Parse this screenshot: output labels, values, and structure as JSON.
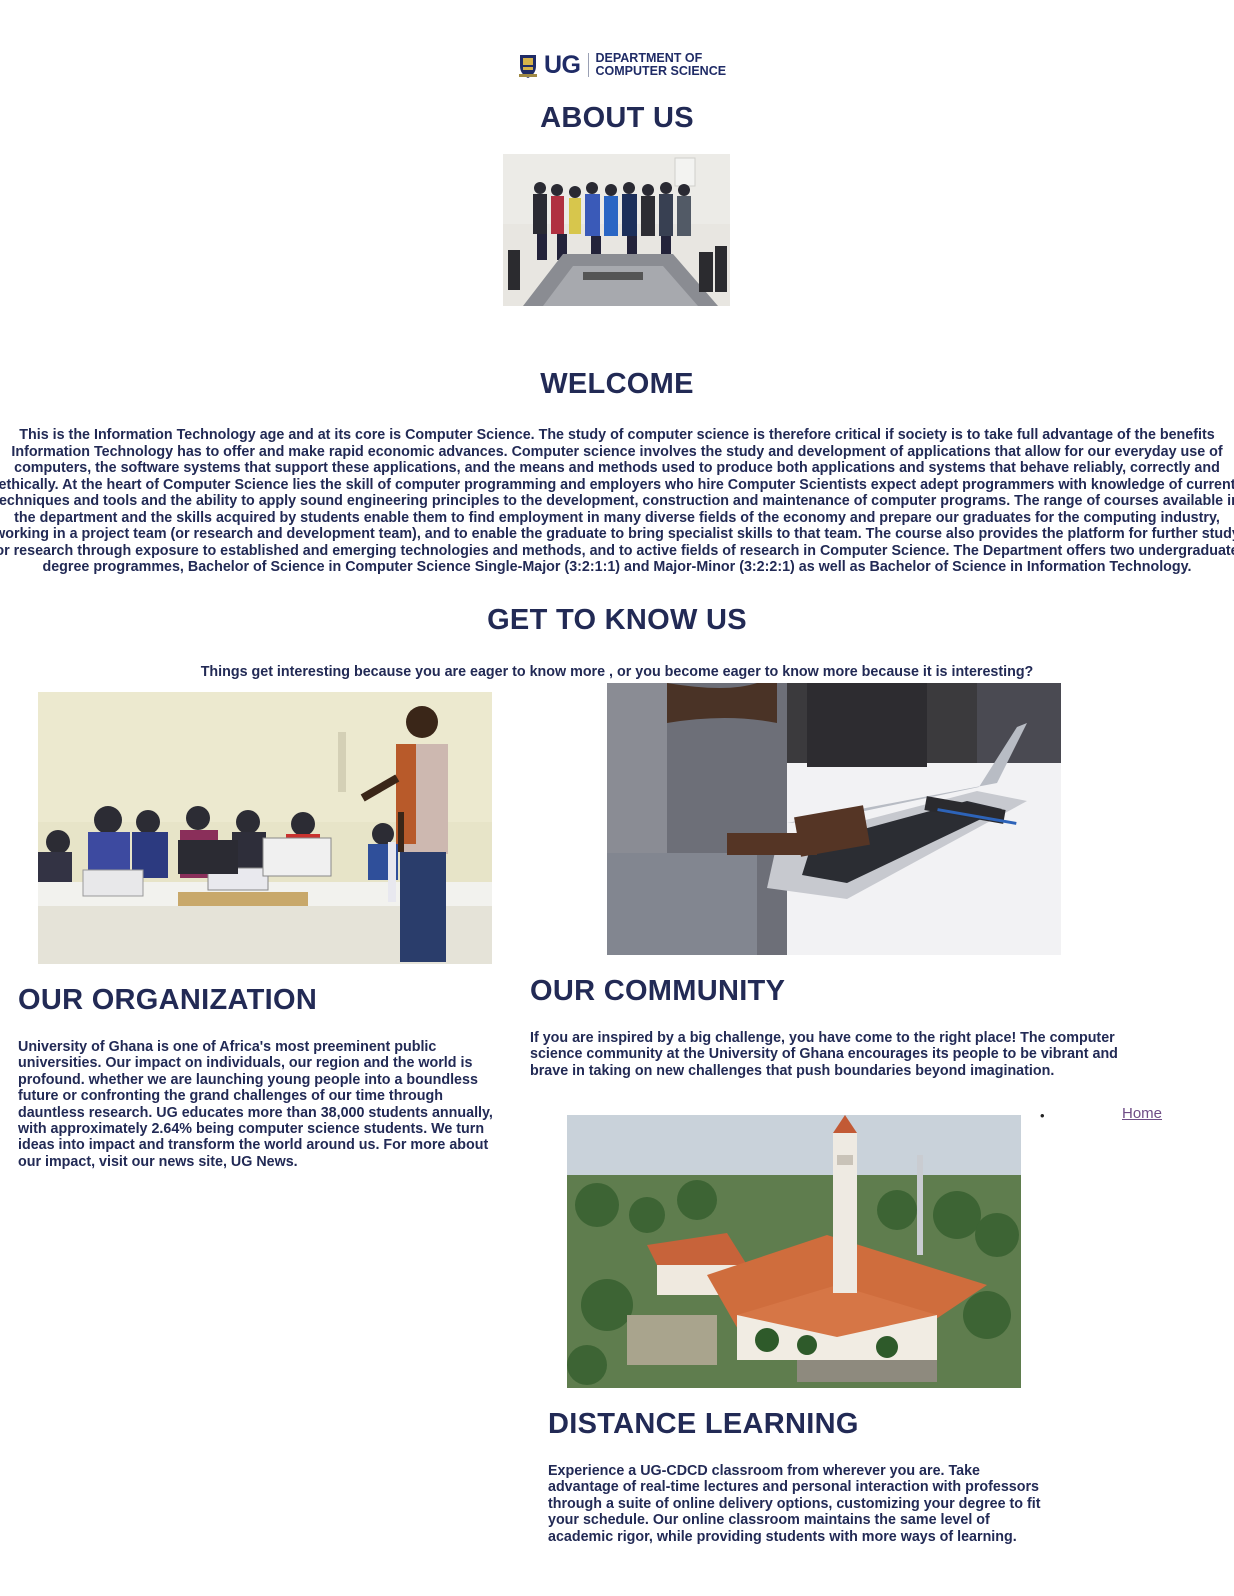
{
  "logo": {
    "abbr": "UG",
    "line1": "DEPARTMENT OF",
    "line2": "COMPUTER SCIENCE"
  },
  "about": {
    "title": "ABOUT US"
  },
  "welcome": {
    "title": "WELCOME",
    "text": "This is the Information Technology age and at its core is Computer Science. The study of computer science is therefore critical if society is to take full advantage of the benefits Information Technology has to offer and make rapid economic advances. Computer science involves the study and development of applications that allow for our everyday use of computers, the software systems that support these applications, and the means and methods used to produce both applications and systems that behave reliably, correctly and ethically. At the heart of Computer Science lies the skill of computer programming and employers who hire Computer Scientists expect adept programmers with knowledge of current techniques and tools and the ability to apply sound engineering principles to the development, construction and maintenance of computer programs. The range of courses available in the department and the skills acquired by students enable them to find employment in many diverse fields of the economy and prepare our graduates for the computing industry, working in a project team (or research and development team), and to enable the graduate to bring specialist skills to that team. The course also provides the platform for further study or research through exposure to established and emerging technologies and methods, and to active fields of research in Computer Science. The Department offers two undergraduate degree programmes, Bachelor of Science in Computer Science Single-Major (3:2:1:1) and Major-Minor (3:2:2:1) as well as Bachelor of Science in Information Technology."
  },
  "get_to_know": {
    "title": "GET TO KNOW US",
    "tagline": "Things get interesting because you are eager to know more , or you become eager to know more because it is interesting?"
  },
  "organization": {
    "title": "OUR ORGANIZATION",
    "text": "University of Ghana is one of Africa's most preeminent public universities. Our impact on individuals, our region and the world is profound. whether we are launching young people into a boundless future or confronting the grand challenges of our time through dauntless research. UG educates more than 38,000 students annually, with approximately 2.64% being computer science students. We turn ideas into impact and transform the world around us. For more about our impact, visit our news site, UG News."
  },
  "community": {
    "title": "OUR COMMUNITY",
    "text": "If you are inspired by a big challenge, you have come to the right place! The computer science community at the University of Ghana encourages its people to be vibrant and brave in taking on new challenges that push boundaries beyond imagination."
  },
  "nav": {
    "home_label": "Home"
  },
  "distance": {
    "title": "DISTANCE LEARNING",
    "text": "Experience a UG-CDCD classroom from wherever you are. Take advantage of real-time lectures and personal interaction with professors through a suite of online delivery options, customizing your degree to fit your schedule. Our online classroom maintains the same level of academic rigor, while providing students with more ways of learning."
  },
  "colors": {
    "heading": "#222a55",
    "link": "#6e4c86"
  }
}
